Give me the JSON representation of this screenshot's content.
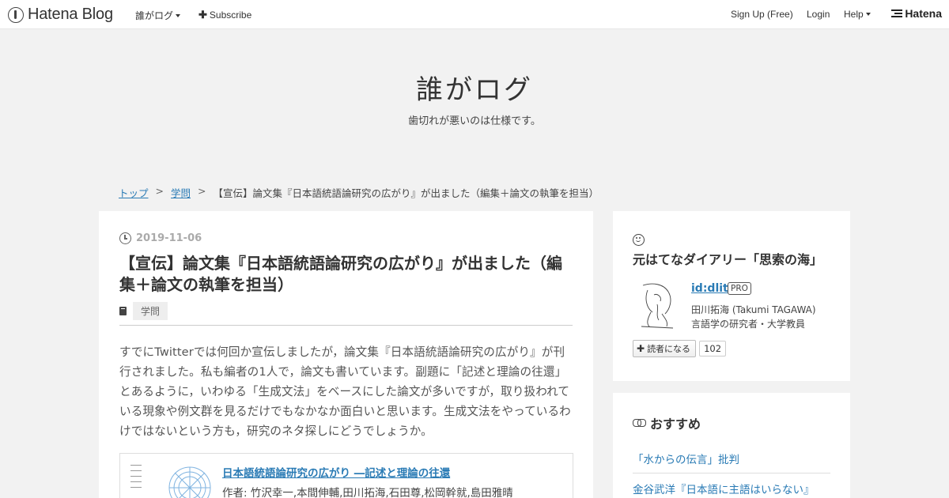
{
  "global_header": {
    "logo_text": "Hatena Blog",
    "blog_menu_label": "誰がログ",
    "subscribe_label": "Subscribe",
    "signup_label": "Sign Up (Free)",
    "login_label": "Login",
    "help_label": "Help",
    "brand_label": "Hatena"
  },
  "blog": {
    "title": "誰がログ",
    "description": "歯切れが悪いのは仕様です。"
  },
  "breadcrumb": {
    "home": "トップ",
    "category": "学問",
    "current": "【宣伝】論文集『日本語統語論研究の広がり』が出ました（編集＋論文の執筆を担当）",
    "separator": ">"
  },
  "entry": {
    "date": "2019-11-06",
    "title": "【宣伝】論文集『日本語統語論研究の広がり』が出ました（編集＋論文の執筆を担当）",
    "category": "学問",
    "body": "すでにTwitterでは何回か宣伝しましたが，論文集『日本語統語論研究の広がり』が刊行されました。私も編者の1人で，論文も書いています。副題に「記述と理論の往還」とあるように，いわゆる「生成文法」をベースにした論文が多いですが，取り扱われている現象や例文群を見るだけでもなかなか面白いと思います。生成文法をやっているわけではないという方も，研究のネタ探しにどうでしょうか。",
    "embed": {
      "title": "日本語統語論研究の広がり ―記述と理論の往還",
      "author": "作者: 竹沢幸一,本間伸輔,田川拓海,石田尊,松岡幹就,島田雅晴"
    }
  },
  "sidebar": {
    "profile": {
      "heading": "元はてなダイアリー「思索の海」",
      "user_id": "id:dlit",
      "badge": "PRO",
      "name": "田川拓海 (Takumi TAGAWA)",
      "description": "言語学の研究者・大学教員",
      "subscribe_label": "読者になる",
      "subscriber_count": "102"
    },
    "recommend": {
      "heading": "おすすめ",
      "items": [
        "「水からの伝言」批判",
        "金谷武洋『日本語に主語はいらない』"
      ]
    }
  },
  "colors": {
    "link": "#2a7bb5",
    "background": "#f2f2f2",
    "card": "#ffffff"
  }
}
